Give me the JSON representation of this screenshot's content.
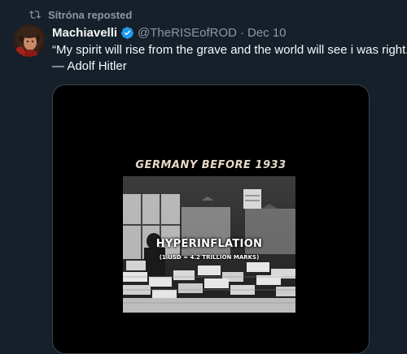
{
  "repost": {
    "label": "Sítróna reposted",
    "icon": "repost-icon"
  },
  "tweet": {
    "avatar_icon": "avatar-portrait",
    "display_name": "Machiavelli",
    "verified_icon": "verified-badge-icon",
    "verified_color": "#1d9bf0",
    "handle": "@TheRISEofROD",
    "separator": "·",
    "date": "Dec 10",
    "text_line1": "“My spirit will rise from the grave and the world will see i was right.”",
    "text_line2": "— Adolf Hitler"
  },
  "media": {
    "caption": "GERMANY BEFORE 1933",
    "overlay_title": "HYPERINFLATION",
    "overlay_subtitle": "(1 USD = 4.2 TRILLION MARKS)"
  },
  "colors": {
    "background": "#15202b",
    "secondary_text": "#8b98a5",
    "primary_text": "#f7f9f9"
  }
}
